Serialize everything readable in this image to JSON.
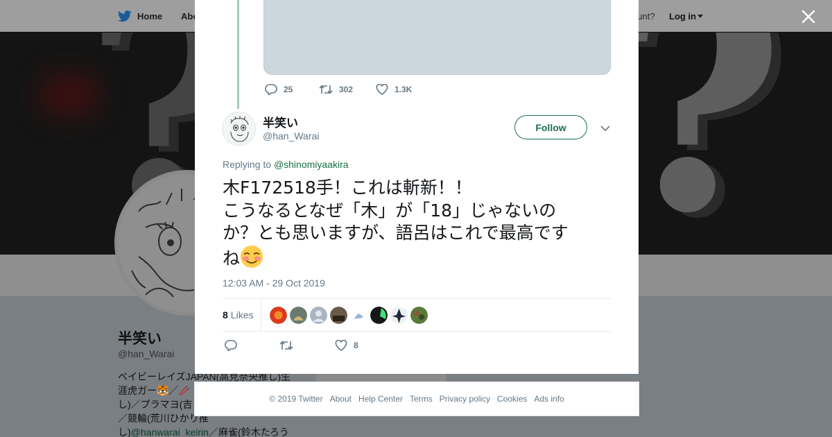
{
  "nav": {
    "home_label": "Home",
    "about_label": "Abo",
    "account_prompt": "ccount?",
    "login_label": "Log in"
  },
  "profile": {
    "name": "半笑い",
    "handle": "@han_Warai",
    "bio_parts": [
      "ベイビーレイズJAPAN(高見奈央推し)生",
      "涯虎ガー🐯／🥢",
      "し)／プラマヨ(吉",
      "／競輪(荒川ひかり推",
      "し)",
      "@hanwarai_keirin",
      "／麻雀(鈴木たろう"
    ],
    "card_label": "Ads info"
  },
  "thread_parent": {
    "reply_count": "25",
    "retweet_count": "302",
    "like_count": "1.3K"
  },
  "tweet": {
    "author_name": "半笑い",
    "author_handle": "@han_Warai",
    "follow_label": "Follow",
    "replying_prefix": "Replying to",
    "replying_to": "@shinomiyaakira",
    "text_lines": [
      "木F172518手！これは斬新！！",
      "こうなるとなぜ「木」が「18」じゃないの",
      "か？とも思いますが、語呂はこれで最高です",
      "ね"
    ],
    "emoji": "☺️",
    "timestamp": "12:03 AM - 29 Oct 2019",
    "likes_number": "8",
    "likes_label": "Likes",
    "like_count": "8",
    "likers": [
      {
        "color": "#d93a1e"
      },
      {
        "color": "#6b7a6e"
      },
      {
        "color": "#aab4be"
      },
      {
        "color": "#6a5a4a"
      },
      {
        "color": "#c9d8ea"
      },
      {
        "color": "#161616"
      },
      {
        "color": "#1e2a3c"
      },
      {
        "color": "#5a7a3a"
      }
    ]
  },
  "footer": {
    "copyright": "© 2019 Twitter",
    "links": [
      "About",
      "Help Center",
      "Terms",
      "Privacy policy",
      "Cookies",
      "Ads info"
    ]
  },
  "colors": {
    "accent": "#17704a",
    "muted": "#657786",
    "thread_line": "#9ed1b4"
  }
}
